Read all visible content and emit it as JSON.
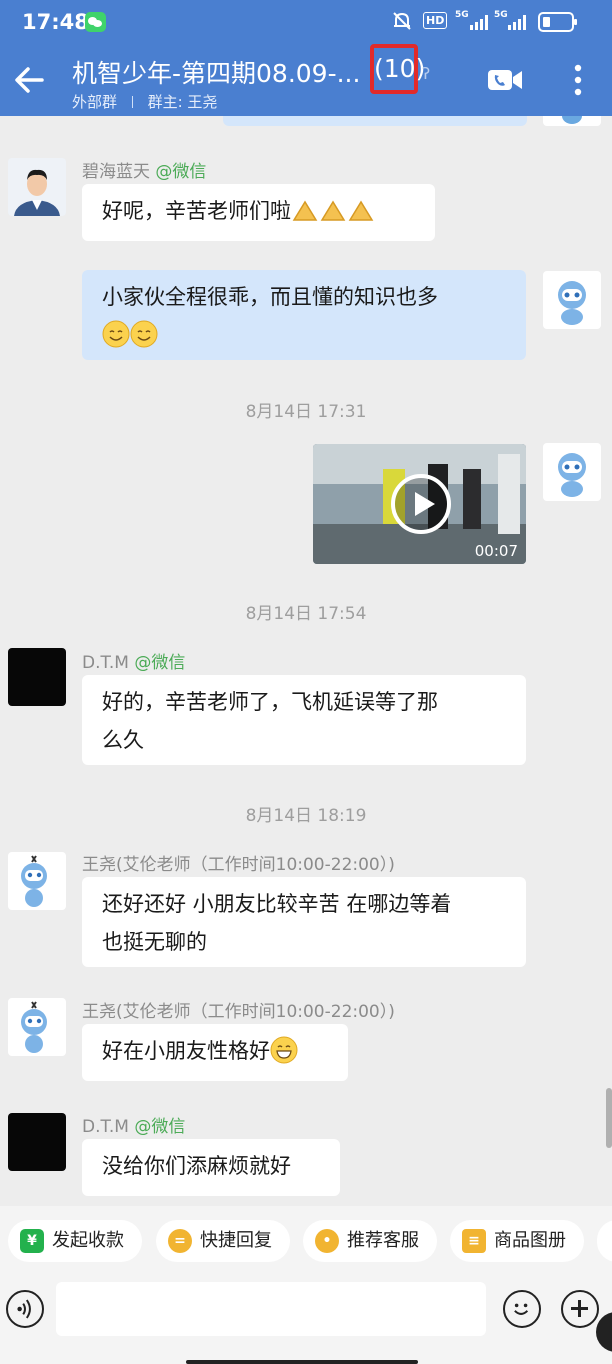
{
  "status_bar": {
    "time": "17:48",
    "hd_label": "HD",
    "signal_1": "5G",
    "signal_2": "5G",
    "icons": [
      "wechat-icon",
      "mute-icon",
      "hd-icon",
      "signal-icon",
      "signal-icon",
      "battery-icon"
    ]
  },
  "header": {
    "title": "机智少年-第四期08.09-...",
    "member_count": "(10)",
    "group_type": "外部群",
    "owner_label": "群主: 王尧",
    "colors": {
      "bar": "#4a7fd0",
      "highlight": "#e22a2a"
    }
  },
  "messages": [
    {
      "sender": "碧海蓝天",
      "sender_tag": "@微信",
      "text": "好呢，辛苦老师们啦",
      "direction": "in"
    },
    {
      "text": "小家伙全程很乖，而且懂的知识也多",
      "direction": "out"
    },
    {
      "timestamp": "8月14日  17:31"
    },
    {
      "video_duration": "00:07",
      "direction": "out"
    },
    {
      "timestamp": "8月14日  17:54"
    },
    {
      "sender": "D.T.M",
      "sender_tag": "@微信",
      "text_lines": [
        "好的，辛苦老师了，飞机延误等了那",
        "么久"
      ],
      "direction": "in"
    },
    {
      "timestamp": "8月14日  18:19"
    },
    {
      "sender": "王尧(艾伦老师（工作时间10:00-22:00）)",
      "text_lines": [
        "还好还好 小朋友比较辛苦 在哪边等着",
        "也挺无聊的"
      ],
      "direction": "in"
    },
    {
      "sender": "王尧(艾伦老师（工作时间10:00-22:00）)",
      "text": "好在小朋友性格好",
      "direction": "in"
    },
    {
      "sender": "D.T.M",
      "sender_tag": "@微信",
      "text": "没给你们添麻烦就好",
      "direction": "in"
    }
  ],
  "quick_actions": [
    {
      "label": "发起收款",
      "icon": "yen-shield-icon",
      "color": "#23b14d"
    },
    {
      "label": "快捷回复",
      "icon": "quick-reply-icon",
      "color": "#f1b431"
    },
    {
      "label": "推荐客服",
      "icon": "service-icon",
      "color": "#f1b431"
    },
    {
      "label": "商品图册",
      "icon": "catalog-icon",
      "color": "#f1b431"
    }
  ],
  "input_bar": {
    "icons": [
      "voice-icon",
      "emoji-icon",
      "plus-icon"
    ]
  }
}
